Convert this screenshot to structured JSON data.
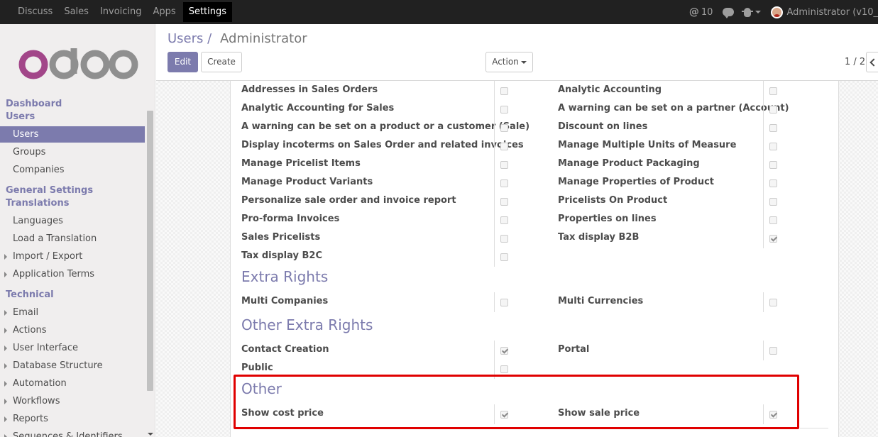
{
  "topbar": {
    "menu": [
      "Discuss",
      "Sales",
      "Invoicing",
      "Apps",
      "Settings"
    ],
    "active": "Settings",
    "messages_at": "@",
    "messages_count": "10",
    "user_label": "Administrator (v10_"
  },
  "sidebar": {
    "logo_text": "odoo",
    "dashboard": "Dashboard",
    "users_section": "Users",
    "users_items": [
      "Users",
      "Groups",
      "Companies"
    ],
    "general_settings": "General Settings",
    "translations": "Translations",
    "translations_items": [
      "Languages",
      "Load a Translation"
    ],
    "translations_expandable": [
      "Import / Export",
      "Application Terms"
    ],
    "technical": "Technical",
    "technical_items": [
      "Email",
      "Actions",
      "User Interface",
      "Database Structure",
      "Automation",
      "Workflows",
      "Reports",
      "Sequences & Identifiers"
    ]
  },
  "control_panel": {
    "breadcrumb_parent": "Users",
    "breadcrumb_sep": "/",
    "breadcrumb_current": "Administrator",
    "edit_label": "Edit",
    "create_label": "Create",
    "action_label": "Action",
    "pager": "1 / 2"
  },
  "rights_rows": [
    {
      "left": "Addresses in Sales Orders",
      "left_checked": false,
      "right": "Analytic Accounting",
      "right_checked": false
    },
    {
      "left": "Analytic Accounting for Sales",
      "left_checked": false,
      "right": "A warning can be set on a partner (Account)",
      "right_checked": false
    },
    {
      "left": "A warning can be set on a product or a customer (Sale)",
      "left_checked": false,
      "right": "Discount on lines",
      "right_checked": false
    },
    {
      "left": "Display incoterms on Sales Order and related invoices",
      "left_checked": false,
      "right": "Manage Multiple Units of Measure",
      "right_checked": false
    },
    {
      "left": "Manage Pricelist Items",
      "left_checked": false,
      "right": "Manage Product Packaging",
      "right_checked": false
    },
    {
      "left": "Manage Product Variants",
      "left_checked": false,
      "right": "Manage Properties of Product",
      "right_checked": false
    },
    {
      "left": "Personalize sale order and invoice report",
      "left_checked": false,
      "right": "Pricelists On Product",
      "right_checked": false
    },
    {
      "left": "Pro-forma Invoices",
      "left_checked": false,
      "right": "Properties on lines",
      "right_checked": false
    },
    {
      "left": "Sales Pricelists",
      "left_checked": false,
      "right": "Tax display B2B",
      "right_checked": true
    },
    {
      "left": "Tax display B2C",
      "left_checked": false,
      "right": "",
      "right_checked": null
    }
  ],
  "extra_rights": {
    "title": "Extra Rights",
    "rows": [
      {
        "left": "Multi Companies",
        "left_checked": false,
        "right": "Multi Currencies",
        "right_checked": false
      }
    ]
  },
  "other_extra_rights": {
    "title": "Other Extra Rights",
    "rows": [
      {
        "left": "Contact Creation",
        "left_checked": true,
        "right": "Portal",
        "right_checked": false
      },
      {
        "left": "Public",
        "left_checked": false,
        "right": "",
        "right_checked": null
      }
    ]
  },
  "other": {
    "title": "Other",
    "rows": [
      {
        "left": "Show cost price",
        "left_checked": true,
        "right": "Show sale price",
        "right_checked": true
      }
    ]
  },
  "colors": {
    "brand": "#7c7bad",
    "topbar": "#212121",
    "highlight": "#e00000"
  }
}
